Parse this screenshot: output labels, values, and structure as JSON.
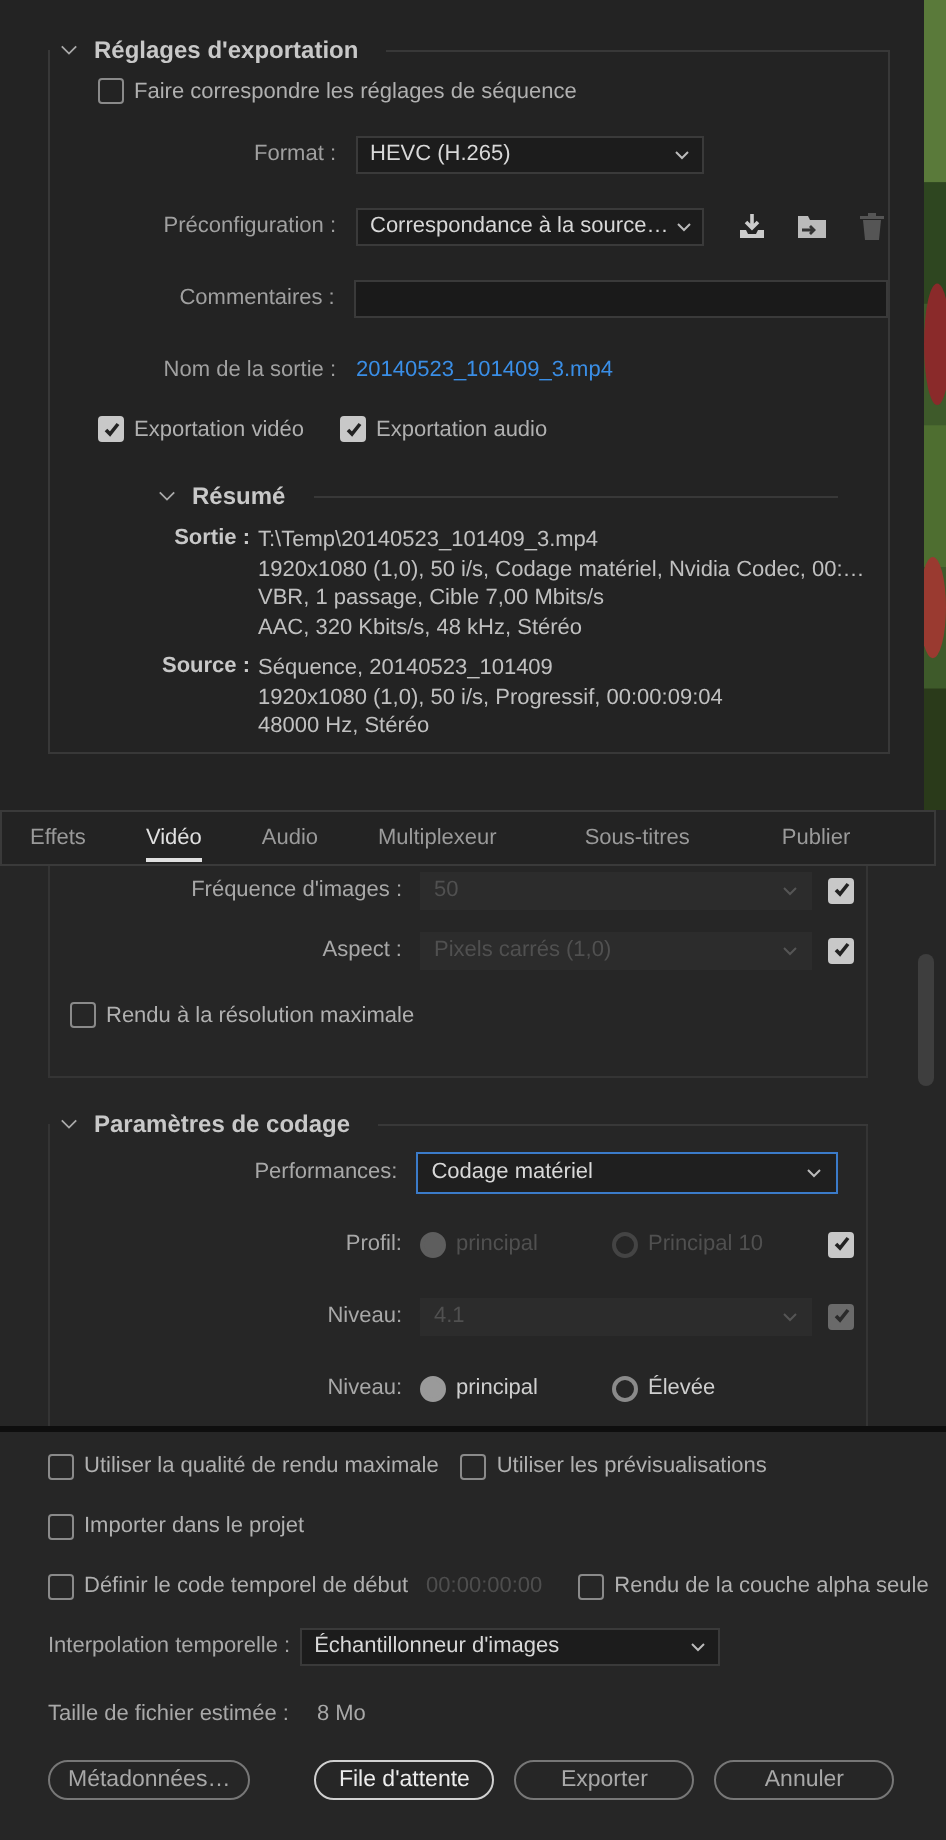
{
  "export_settings": {
    "title": "Réglages d'exportation",
    "expanded": true,
    "match_sequence": {
      "label": "Faire correspondre les réglages de séquence",
      "checked": false
    },
    "format": {
      "label": "Format :",
      "value": "HEVC (H.265)"
    },
    "preset": {
      "label": "Préconfiguration :",
      "value": "Correspondance à la source…"
    },
    "comments": {
      "label": "Commentaires :"
    },
    "output_name": {
      "label": "Nom de la sortie :",
      "value": "20140523_101409_3.mp4"
    },
    "export_video": {
      "label": "Exportation vidéo",
      "checked": true
    },
    "export_audio": {
      "label": "Exportation audio",
      "checked": true
    },
    "summary": {
      "title": "Résumé",
      "expanded": true,
      "groups": [
        {
          "label": "Sortie :",
          "lines": [
            "T:\\Temp\\20140523_101409_3.mp4",
            "1920x1080 (1,0), 50 i/s, Codage matériel, Nvidia Codec, 00:…",
            "VBR, 1 passage, Cible 7,00  Mbits/s",
            "AAC, 320  Kbits/s, 48  kHz, Stéréo"
          ]
        },
        {
          "label": "Source :",
          "lines": [
            "Séquence, 20140523_101409",
            "1920x1080 (1,0), 50  i/s, Progressif, 00:00:09:04",
            "48000 Hz, Stéréo"
          ]
        }
      ]
    }
  },
  "tabs": [
    {
      "label": "Effets",
      "selected": false
    },
    {
      "label": "Vidéo",
      "selected": true
    },
    {
      "label": "Audio",
      "selected": false
    },
    {
      "label": "Multiplexeur",
      "selected": false
    },
    {
      "label": "Sous-titres",
      "selected": false
    },
    {
      "label": "Publier",
      "selected": false
    }
  ],
  "video_settings": {
    "rows": [
      {
        "label": "Fréquence d'images :",
        "value": "50",
        "checked": true,
        "disabled": true
      },
      {
        "label": "Aspect :",
        "value": "Pixels carrés (1,0)",
        "checked": true,
        "disabled": true
      }
    ],
    "max_resolution": {
      "label": "Rendu à la résolution maximale",
      "checked": false
    }
  },
  "encoding": {
    "title": "Paramètres de codage",
    "expanded": true,
    "performance": {
      "label": "Performances:",
      "value": "Codage matériel",
      "focused": true
    },
    "profile": {
      "label": "Profil:",
      "disabled": true,
      "checked": true,
      "options": [
        {
          "label": "principal",
          "selected": true
        },
        {
          "label": "Principal 10",
          "selected": false
        }
      ]
    },
    "level": {
      "label": "Niveau:",
      "value": "4.1",
      "disabled": true,
      "checked": true
    },
    "tier": {
      "label": "Niveau:",
      "disabled": false,
      "options": [
        {
          "label": "principal",
          "selected": true
        },
        {
          "label": "Élevée",
          "selected": false
        }
      ]
    }
  },
  "options": [
    {
      "label": "Utiliser la qualité de rendu maximale",
      "checked": false
    },
    {
      "label": "Utiliser les prévisualisations",
      "checked": false
    },
    {
      "label": "Importer dans le projet",
      "checked": false
    },
    {
      "label": "Définir le code temporel de début",
      "checked": false,
      "value": "00:00:00:00"
    },
    {
      "label": "Rendu de la couche alpha seule",
      "checked": false
    }
  ],
  "interpolation": {
    "label": "Interpolation temporelle :",
    "value": "Échantillonneur d'images"
  },
  "file_size": {
    "label": "Taille de fichier estimée :",
    "value": "8 Mo"
  },
  "buttons": [
    {
      "label": "Métadonnées…",
      "default": false
    },
    {
      "label": "File d'attente",
      "default": true
    },
    {
      "label": "Exporter",
      "default": false
    },
    {
      "label": "Annuler",
      "default": false
    }
  ]
}
